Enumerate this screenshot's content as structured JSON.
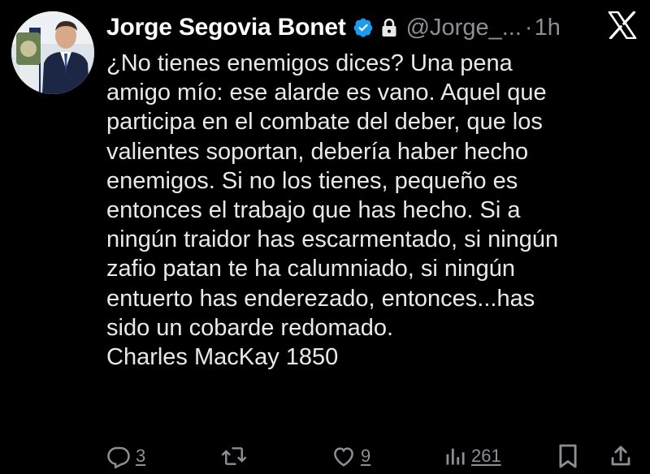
{
  "tweet": {
    "author_name": "Jorge Segovia Bonet",
    "handle": "@Jorge_...",
    "separator": "·",
    "time": "1h",
    "verified_icon": "verified-badge-icon",
    "lock_icon": "lock-icon",
    "platform_icon": "x-logo-icon",
    "text": "¿No tienes enemigos dices? Una pena\namigo mío: ese alarde es vano. Aquel que\nparticipa en el combate del deber, que los\nvalientes soportan, debería haber hecho\nenemigos. Si no los tienes, pequeño es\nentonces el trabajo que has hecho. Si a\nningún traidor has escarmentado, si ningún\nzafio patan te ha calumniado, si ningún\nentuerto has enderezado, entonces...has\nsido un cobarde redomado.\nCharles MacKay 1850"
  },
  "actions": {
    "replies": "3",
    "retweets": "",
    "likes": "9",
    "views": "261"
  },
  "colors": {
    "background": "#000000",
    "text": "#e7e9ea",
    "muted": "#8b9096",
    "verified": "#1d9bf0"
  }
}
